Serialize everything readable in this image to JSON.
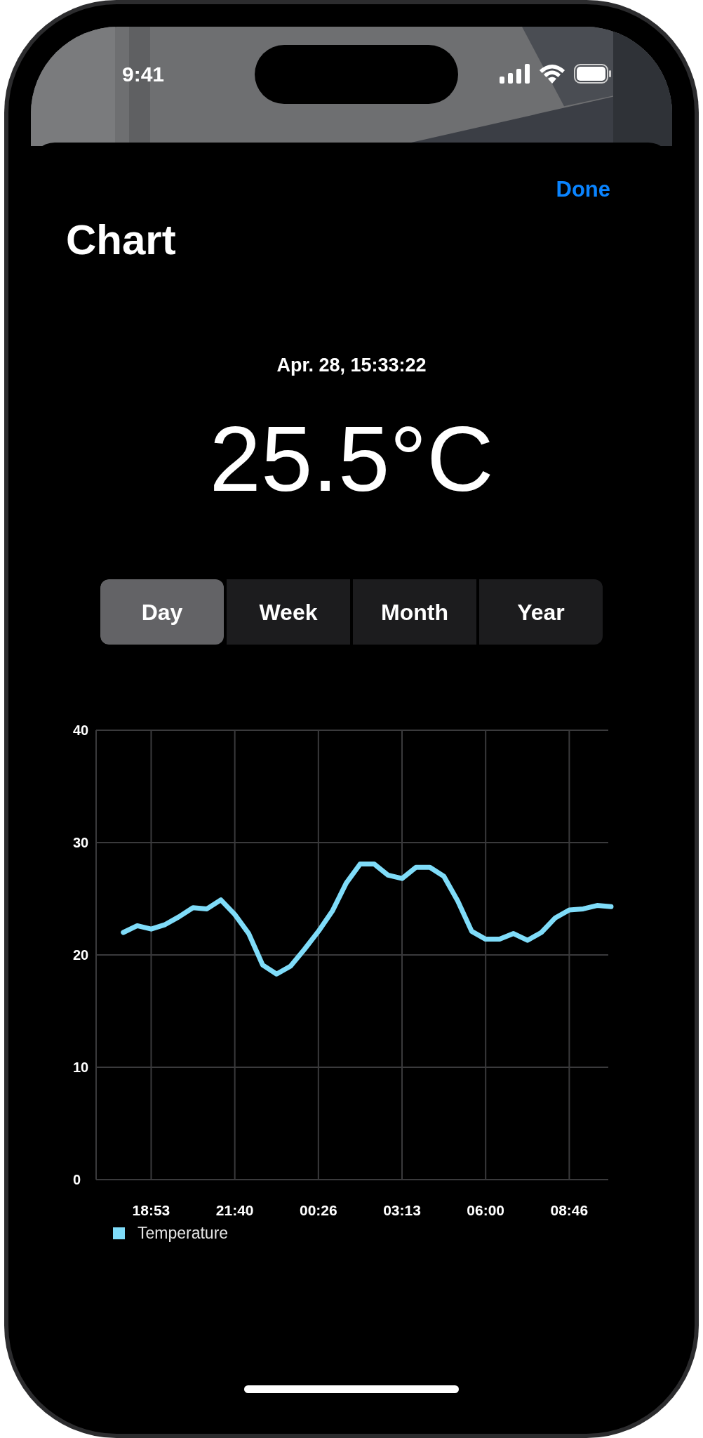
{
  "status_bar": {
    "time": "9:41"
  },
  "nav": {
    "done": "Done",
    "title": "Chart"
  },
  "reading": {
    "timestamp": "Apr. 28, 15:33:22",
    "value": "25.5°C"
  },
  "range_tabs": [
    {
      "label": "Day",
      "selected": true
    },
    {
      "label": "Week",
      "selected": false
    },
    {
      "label": "Month",
      "selected": false
    },
    {
      "label": "Year",
      "selected": false
    }
  ],
  "chart": {
    "chart_data": {
      "type": "line",
      "grid": true,
      "categories": [
        null,
        null,
        "18:53",
        null,
        null,
        null,
        null,
        null,
        "21:40",
        null,
        null,
        null,
        null,
        null,
        "00:26",
        null,
        null,
        null,
        null,
        null,
        "03:13",
        null,
        null,
        null,
        null,
        null,
        "06:00",
        null,
        null,
        null,
        null,
        null,
        "08:46",
        null,
        null,
        null
      ],
      "series": [
        {
          "name": "Temperature",
          "color": "#7fdcf9",
          "values": [
            22.0,
            22.6,
            22.3,
            22.7,
            23.4,
            24.2,
            24.1,
            24.9,
            23.6,
            21.9,
            19.1,
            18.3,
            19.0,
            20.5,
            22.1,
            23.9,
            26.4,
            28.1,
            28.1,
            27.1,
            26.8,
            27.8,
            27.8,
            27.0,
            24.8,
            22.1,
            21.4,
            21.4,
            21.9,
            21.3,
            22.0,
            23.3,
            24.0,
            24.1,
            24.4,
            24.3
          ]
        }
      ],
      "ylim": [
        0,
        40
      ],
      "yticks": [
        0,
        10,
        20,
        30,
        40
      ]
    }
  }
}
